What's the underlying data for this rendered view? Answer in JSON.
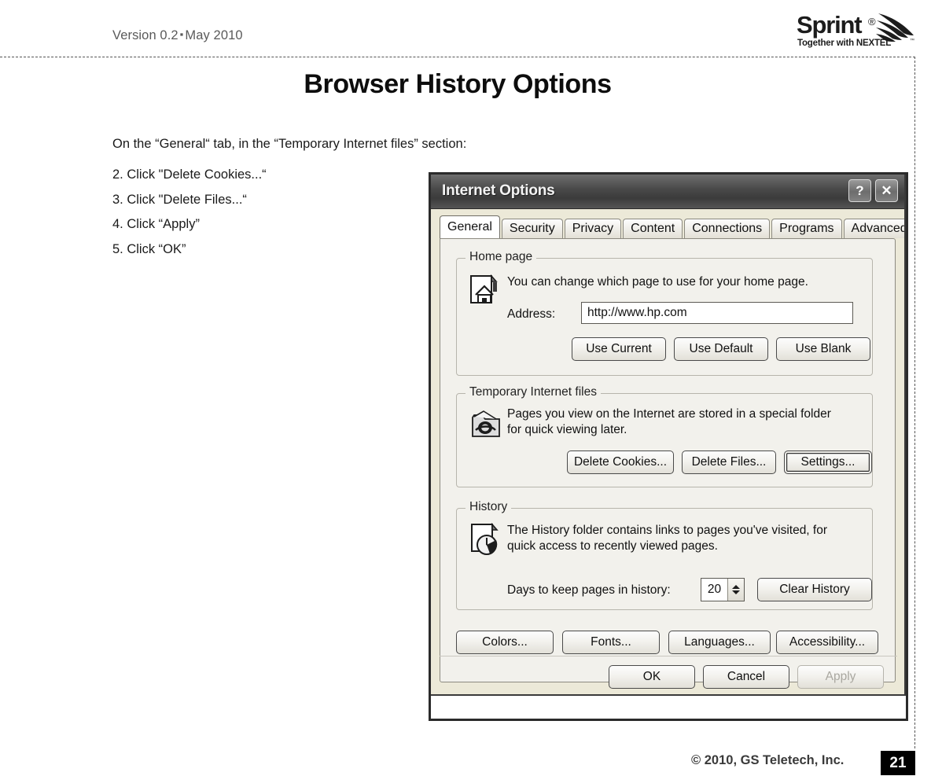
{
  "header": {
    "version_text": "Version 0.2",
    "separator": "▪",
    "date_text": "May 2010",
    "logo_word": "Sprint",
    "logo_star": "®",
    "logo_tagline": "Together with NEXTEL"
  },
  "document": {
    "title": "Browser History Options",
    "intro": "On the “General“ tab, in the “Temporary Internet files” section:",
    "steps": [
      "2. Click \"Delete Cookies...“",
      "3. Click \"Delete Files...“",
      "4. Click “Apply”",
      "5. Click “OK”"
    ]
  },
  "footer": {
    "copyright": "© 2010, GS Teletech, Inc.",
    "page_number": "21"
  },
  "dialog": {
    "title": "Internet Options",
    "help_button": "?",
    "close_button": "✕",
    "tabs": [
      {
        "label": "General",
        "active": true
      },
      {
        "label": "Security",
        "active": false
      },
      {
        "label": "Privacy",
        "active": false
      },
      {
        "label": "Content",
        "active": false
      },
      {
        "label": "Connections",
        "active": false
      },
      {
        "label": "Programs",
        "active": false
      },
      {
        "label": "Advanced",
        "active": false
      }
    ],
    "home_page": {
      "legend": "Home page",
      "description": "You can change which page to use for your home page.",
      "address_label": "Address:",
      "address_value": "http://www.hp.com",
      "buttons": [
        "Use Current",
        "Use Default",
        "Use Blank"
      ]
    },
    "temporary_files": {
      "legend": "Temporary Internet files",
      "description_line1": "Pages you view on the Internet are stored in a special folder",
      "description_line2": "for quick viewing later.",
      "buttons": [
        "Delete Cookies...",
        "Delete Files...",
        "Settings..."
      ],
      "focused_button": "Settings..."
    },
    "history": {
      "legend": "History",
      "description_line1": "The History folder contains links to pages you've visited, for",
      "description_line2": "quick access to recently viewed pages.",
      "days_label": "Days to keep pages in history:",
      "days_value": "20",
      "clear_button": "Clear History"
    },
    "appearance_buttons": [
      "Colors...",
      "Fonts...",
      "Languages...",
      "Accessibility..."
    ],
    "action_buttons": [
      {
        "label": "OK",
        "disabled": false
      },
      {
        "label": "Cancel",
        "disabled": false
      },
      {
        "label": "Apply",
        "disabled": true
      }
    ]
  },
  "colors": {
    "page_background": "#ffffff",
    "titlebar": "#4a4a4a",
    "dialog_face": "#f2f1ec",
    "text": "#1a1a1a",
    "muted_text": "#5a5a5a",
    "page_badge_background": "#000000"
  }
}
